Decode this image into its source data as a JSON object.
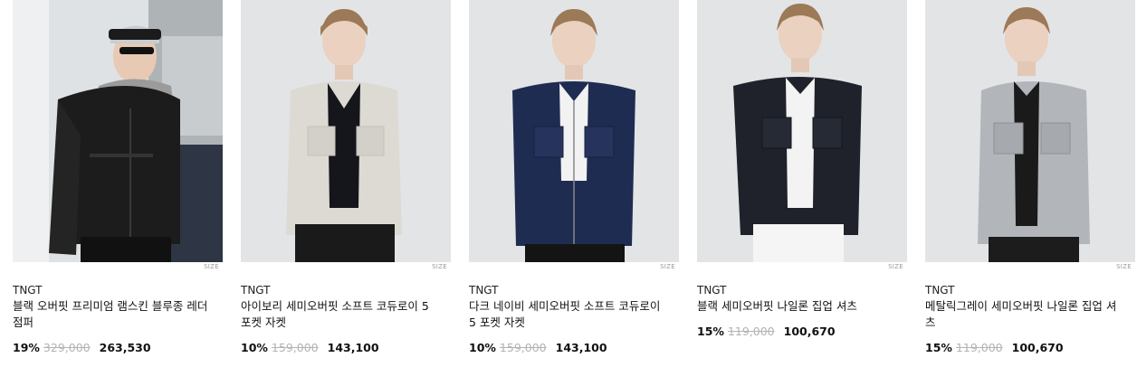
{
  "products": [
    {
      "brand": "TNGT",
      "title": "블랙 오버핏 프리미엄 램스킨 블루종 레더 점퍼",
      "discount": "19%",
      "original_price": "329,000",
      "price": "263,530",
      "size_label": "SIZE",
      "bg": "#d9dde0",
      "garment_color": "#1c1c1c",
      "inner_color": "#7a7a7a"
    },
    {
      "brand": "TNGT",
      "title": "아이보리 세미오버핏 소프트 코듀로이 5 포켓 자켓",
      "discount": "10%",
      "original_price": "159,000",
      "price": "143,100",
      "size_label": "SIZE",
      "bg": "#e3e4e6",
      "garment_color": "#dcdad3",
      "inner_color": "#15161c"
    },
    {
      "brand": "TNGT",
      "title": "다크 네이비 세미오버핏 소프트 코듀로이 5 포켓 자켓",
      "discount": "10%",
      "original_price": "159,000",
      "price": "143,100",
      "size_label": "SIZE",
      "bg": "#e3e4e6",
      "garment_color": "#1f2c52",
      "inner_color": "#f2f2f2"
    },
    {
      "brand": "TNGT",
      "title": "블랙 세미오버핏 나일론 집업 셔츠",
      "discount": "15%",
      "original_price": "119,000",
      "price": "100,670",
      "size_label": "SIZE",
      "bg": "#e3e4e6",
      "garment_color": "#1f222b",
      "inner_color": "#f3f3f3"
    },
    {
      "brand": "TNGT",
      "title": "메탈릭그레이 세미오버핏 나일론 집업 셔츠",
      "discount": "15%",
      "original_price": "119,000",
      "price": "100,670",
      "size_label": "SIZE",
      "bg": "#e3e4e6",
      "garment_color": "#b2b6bb",
      "inner_color": "#1a1a1a"
    }
  ]
}
